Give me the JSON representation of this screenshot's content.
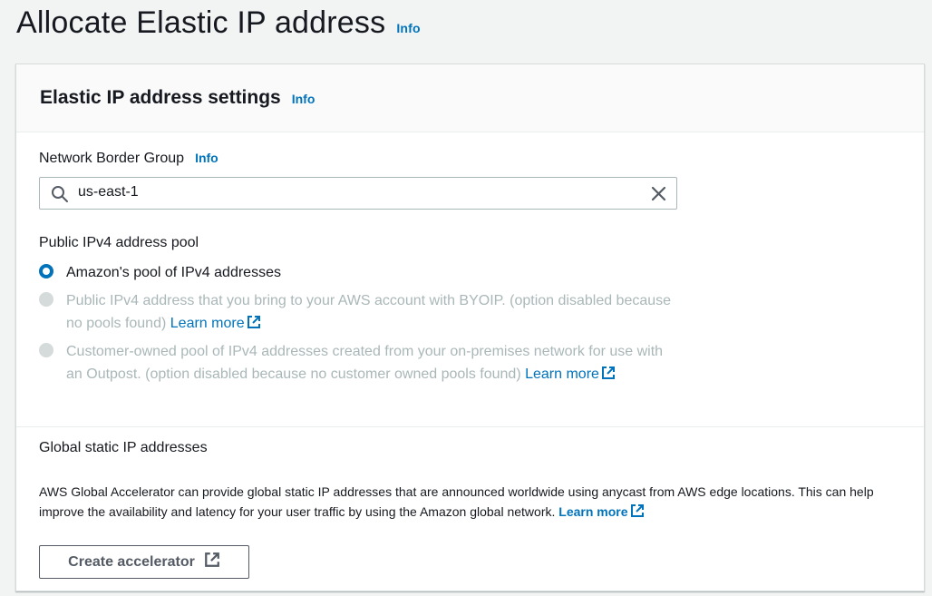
{
  "page": {
    "title": "Allocate Elastic IP address",
    "info_label": "Info"
  },
  "settings_panel": {
    "title": "Elastic IP address settings",
    "info_label": "Info",
    "network_border_group": {
      "label": "Network Border Group",
      "info_label": "Info",
      "value": "us-east-1"
    },
    "ipv4_pool": {
      "label": "Public IPv4 address pool",
      "options": [
        {
          "label": "Amazon's pool of IPv4 addresses",
          "selected": true,
          "disabled": false
        },
        {
          "label": "Public IPv4 address that you bring to your AWS account with BYOIP. (option disabled because no pools found)",
          "link": "Learn more",
          "selected": false,
          "disabled": true
        },
        {
          "label": "Customer-owned pool of IPv4 addresses created from your on-premises network for use with an Outpost. (option disabled because no customer owned pools found)",
          "link": "Learn more",
          "selected": false,
          "disabled": true
        }
      ]
    },
    "global_static": {
      "label": "Global static IP addresses",
      "description": "AWS Global Accelerator can provide global static IP addresses that are announced worldwide using anycast from AWS edge locations. This can help improve the availability and latency for your user traffic by using the Amazon global network.",
      "link": "Learn more",
      "button_label": "Create accelerator"
    }
  },
  "colors": {
    "link": "#0073bb",
    "disabled_text": "#aab7b8",
    "button_border": "#545b64"
  },
  "icons": {
    "search": "search-icon",
    "clear": "close-icon",
    "external": "external-link-icon"
  }
}
